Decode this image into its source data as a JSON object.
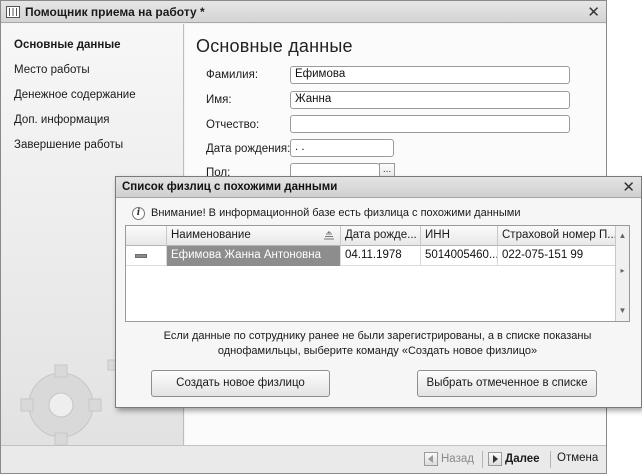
{
  "window": {
    "title": "Помощник приема на работу *",
    "close_glyph": "✕"
  },
  "sidebar": {
    "items": [
      {
        "label": "Основные данные",
        "active": true
      },
      {
        "label": "Место работы",
        "active": false
      },
      {
        "label": "Денежное содержание",
        "active": false
      },
      {
        "label": "Доп. информация",
        "active": false
      },
      {
        "label": "Завершение работы",
        "active": false
      }
    ]
  },
  "main": {
    "title": "Основные данные",
    "fields": {
      "surname": {
        "label": "Фамилия:",
        "value": "Ефимова"
      },
      "name": {
        "label": "Имя:",
        "value": "Жанна"
      },
      "patronymic": {
        "label": "Отчество:",
        "value": ""
      },
      "birthdate": {
        "label": "Дата рождения:",
        "value": " .  .  "
      },
      "gender": {
        "label": "Пол:",
        "value": "",
        "button": "..."
      }
    }
  },
  "footer": {
    "back_label": "Назад",
    "next_label": "Далее",
    "cancel_label": "Отмена"
  },
  "dialog": {
    "title": "Список физлиц с похожими данными",
    "close_glyph": "✕",
    "info_glyph": "i",
    "info_text": "Внимание! В информационной базе есть физлица с похожими данными",
    "table": {
      "columns": [
        "Наименование",
        "Дата рожде...",
        "ИНН",
        "Страховой номер П..."
      ],
      "rows": [
        [
          "Ефимова Жанна Антоновна",
          "04.11.1978",
          "5014005460...",
          "022-075-151 99"
        ]
      ]
    },
    "note_line1": "Если данные по сотруднику ранее не были зарегистрированы, а в списке показаны",
    "note_line2": "однофамильцы, выберите команду «Создать новое физлицо»",
    "create_button": "Создать новое физлицо",
    "select_button": "Выбрать отмеченное в списке"
  }
}
